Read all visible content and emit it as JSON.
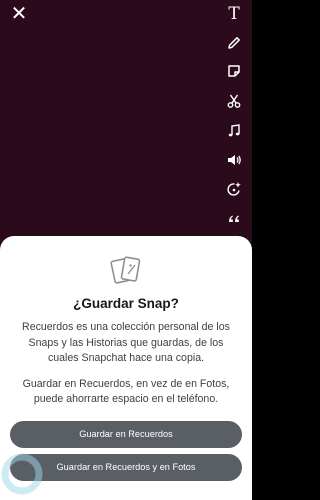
{
  "screen": {
    "background_color": "#2b0a1c",
    "close_icon": "close-icon"
  },
  "toolbar": {
    "text_tool_glyph": "T",
    "icons": [
      "text-icon",
      "pencil-icon",
      "sticker-icon",
      "scissors-icon",
      "music-icon",
      "sound-icon",
      "magic-icon",
      "quote-icon"
    ]
  },
  "dialog": {
    "icon": "snap-card-icon",
    "title": "¿Guardar Snap?",
    "body_1": "Recuerdos es una colección personal de los Snaps y las Historias que guardas, de los cuales Snapchat hace una copia.",
    "body_2": "Guardar en Recuerdos, en vez de en Fotos, puede ahorrarte espacio en el teléfono.",
    "primary_button": "Guardar en Recuerdos",
    "secondary_button": "Guardar en Recuerdos y en Fotos",
    "button_color": "#5a5f66"
  }
}
